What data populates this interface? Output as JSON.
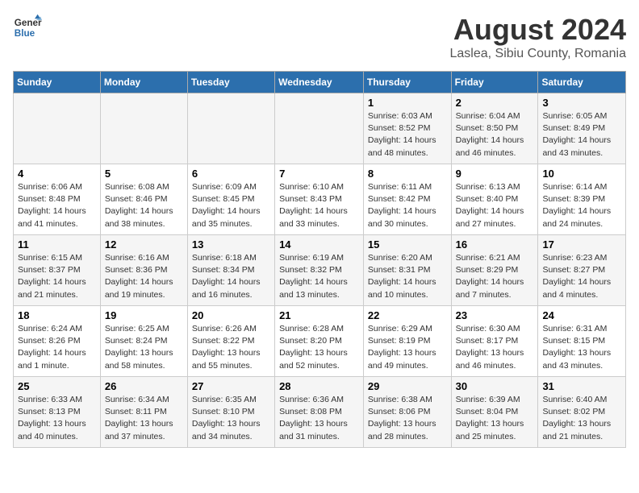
{
  "header": {
    "logo_line1": "General",
    "logo_line2": "Blue",
    "month": "August 2024",
    "location": "Laslea, Sibiu County, Romania"
  },
  "weekdays": [
    "Sunday",
    "Monday",
    "Tuesday",
    "Wednesday",
    "Thursday",
    "Friday",
    "Saturday"
  ],
  "weeks": [
    [
      {
        "day": "",
        "info": ""
      },
      {
        "day": "",
        "info": ""
      },
      {
        "day": "",
        "info": ""
      },
      {
        "day": "",
        "info": ""
      },
      {
        "day": "1",
        "info": "Sunrise: 6:03 AM\nSunset: 8:52 PM\nDaylight: 14 hours and 48 minutes."
      },
      {
        "day": "2",
        "info": "Sunrise: 6:04 AM\nSunset: 8:50 PM\nDaylight: 14 hours and 46 minutes."
      },
      {
        "day": "3",
        "info": "Sunrise: 6:05 AM\nSunset: 8:49 PM\nDaylight: 14 hours and 43 minutes."
      }
    ],
    [
      {
        "day": "4",
        "info": "Sunrise: 6:06 AM\nSunset: 8:48 PM\nDaylight: 14 hours and 41 minutes."
      },
      {
        "day": "5",
        "info": "Sunrise: 6:08 AM\nSunset: 8:46 PM\nDaylight: 14 hours and 38 minutes."
      },
      {
        "day": "6",
        "info": "Sunrise: 6:09 AM\nSunset: 8:45 PM\nDaylight: 14 hours and 35 minutes."
      },
      {
        "day": "7",
        "info": "Sunrise: 6:10 AM\nSunset: 8:43 PM\nDaylight: 14 hours and 33 minutes."
      },
      {
        "day": "8",
        "info": "Sunrise: 6:11 AM\nSunset: 8:42 PM\nDaylight: 14 hours and 30 minutes."
      },
      {
        "day": "9",
        "info": "Sunrise: 6:13 AM\nSunset: 8:40 PM\nDaylight: 14 hours and 27 minutes."
      },
      {
        "day": "10",
        "info": "Sunrise: 6:14 AM\nSunset: 8:39 PM\nDaylight: 14 hours and 24 minutes."
      }
    ],
    [
      {
        "day": "11",
        "info": "Sunrise: 6:15 AM\nSunset: 8:37 PM\nDaylight: 14 hours and 21 minutes."
      },
      {
        "day": "12",
        "info": "Sunrise: 6:16 AM\nSunset: 8:36 PM\nDaylight: 14 hours and 19 minutes."
      },
      {
        "day": "13",
        "info": "Sunrise: 6:18 AM\nSunset: 8:34 PM\nDaylight: 14 hours and 16 minutes."
      },
      {
        "day": "14",
        "info": "Sunrise: 6:19 AM\nSunset: 8:32 PM\nDaylight: 14 hours and 13 minutes."
      },
      {
        "day": "15",
        "info": "Sunrise: 6:20 AM\nSunset: 8:31 PM\nDaylight: 14 hours and 10 minutes."
      },
      {
        "day": "16",
        "info": "Sunrise: 6:21 AM\nSunset: 8:29 PM\nDaylight: 14 hours and 7 minutes."
      },
      {
        "day": "17",
        "info": "Sunrise: 6:23 AM\nSunset: 8:27 PM\nDaylight: 14 hours and 4 minutes."
      }
    ],
    [
      {
        "day": "18",
        "info": "Sunrise: 6:24 AM\nSunset: 8:26 PM\nDaylight: 14 hours and 1 minute."
      },
      {
        "day": "19",
        "info": "Sunrise: 6:25 AM\nSunset: 8:24 PM\nDaylight: 13 hours and 58 minutes."
      },
      {
        "day": "20",
        "info": "Sunrise: 6:26 AM\nSunset: 8:22 PM\nDaylight: 13 hours and 55 minutes."
      },
      {
        "day": "21",
        "info": "Sunrise: 6:28 AM\nSunset: 8:20 PM\nDaylight: 13 hours and 52 minutes."
      },
      {
        "day": "22",
        "info": "Sunrise: 6:29 AM\nSunset: 8:19 PM\nDaylight: 13 hours and 49 minutes."
      },
      {
        "day": "23",
        "info": "Sunrise: 6:30 AM\nSunset: 8:17 PM\nDaylight: 13 hours and 46 minutes."
      },
      {
        "day": "24",
        "info": "Sunrise: 6:31 AM\nSunset: 8:15 PM\nDaylight: 13 hours and 43 minutes."
      }
    ],
    [
      {
        "day": "25",
        "info": "Sunrise: 6:33 AM\nSunset: 8:13 PM\nDaylight: 13 hours and 40 minutes."
      },
      {
        "day": "26",
        "info": "Sunrise: 6:34 AM\nSunset: 8:11 PM\nDaylight: 13 hours and 37 minutes."
      },
      {
        "day": "27",
        "info": "Sunrise: 6:35 AM\nSunset: 8:10 PM\nDaylight: 13 hours and 34 minutes."
      },
      {
        "day": "28",
        "info": "Sunrise: 6:36 AM\nSunset: 8:08 PM\nDaylight: 13 hours and 31 minutes."
      },
      {
        "day": "29",
        "info": "Sunrise: 6:38 AM\nSunset: 8:06 PM\nDaylight: 13 hours and 28 minutes."
      },
      {
        "day": "30",
        "info": "Sunrise: 6:39 AM\nSunset: 8:04 PM\nDaylight: 13 hours and 25 minutes."
      },
      {
        "day": "31",
        "info": "Sunrise: 6:40 AM\nSunset: 8:02 PM\nDaylight: 13 hours and 21 minutes."
      }
    ]
  ]
}
